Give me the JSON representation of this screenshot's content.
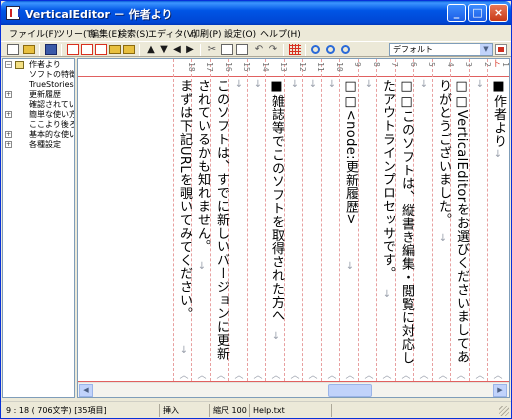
{
  "window": {
    "title": "VerticalEditor － 作者より",
    "minimize": "_",
    "maximize": "□",
    "close": "×"
  },
  "menu": [
    {
      "label": "ファイル(F)"
    },
    {
      "label": "ツリー(T)"
    },
    {
      "label": "編集(E)"
    },
    {
      "label": "検索(S)"
    },
    {
      "label": "エディタ(V)"
    },
    {
      "label": "印刷(P)"
    },
    {
      "label": "設定(O)"
    },
    {
      "label": "ヘルプ(H)"
    }
  ],
  "toolbar": {
    "font_select": "デフォルト",
    "font_select_arrow": "▼",
    "up_arrow": "▲",
    "down_arrow": "▼",
    "left_arrow": "◀",
    "right_arrow": "▶",
    "cut": "✂",
    "undo": "↶",
    "redo": "↷"
  },
  "tree": {
    "items": [
      {
        "exp": "−",
        "label": "作者より"
      },
      {
        "exp": "",
        "label": "ソフトの特徴"
      },
      {
        "exp": "",
        "label": "TrueStories"
      },
      {
        "exp": "+",
        "label": "更新履歴"
      },
      {
        "exp": "",
        "label": "確認されている"
      },
      {
        "exp": "+",
        "label": "簡単な使い方"
      },
      {
        "exp": "",
        "label": "ここより後ろ"
      },
      {
        "exp": "+",
        "label": "基本的な使い"
      },
      {
        "exp": "+",
        "label": "各種設定"
      }
    ]
  },
  "editor": {
    "top_marker": "卜",
    "lines": [
      {
        "num": "1",
        "text": "■作者より",
        "eol": "↓"
      },
      {
        "num": "2",
        "text": "",
        "eol": "↓"
      },
      {
        "num": "3",
        "text": "□□VerticalEditorをお選びくださいましてあ",
        "eol": ""
      },
      {
        "num": "4",
        "text": "りがとうございました。",
        "eol": "↓"
      },
      {
        "num": "5",
        "text": "",
        "eol": "↓"
      },
      {
        "num": "6",
        "text": "□□このソフトは、縦書き編集・閲覧に対応し",
        "eol": ""
      },
      {
        "num": "7",
        "text": "たアウトラインプロセッサです。",
        "eol": "↓"
      },
      {
        "num": "8",
        "text": "",
        "eol": "↓"
      },
      {
        "num": "9",
        "text": "□□<node:更新履歴>",
        "eol": "↓"
      },
      {
        "num": "10",
        "text": "",
        "eol": "↓"
      },
      {
        "num": "11",
        "text": "",
        "eol": "↓"
      },
      {
        "num": "12",
        "text": "",
        "eol": "↓"
      },
      {
        "num": "13",
        "text": "■雑誌等でこのソフトを取得された方へ",
        "eol": "↓"
      },
      {
        "num": "14",
        "text": "",
        "eol": "↓"
      },
      {
        "num": "15",
        "text": "",
        "eol": "↓"
      },
      {
        "num": "16",
        "text": "このソフトは、すでに新しいバージョンに更新",
        "eol": ""
      },
      {
        "num": "17",
        "text": "されているかも知れません。",
        "eol": "↓"
      },
      {
        "num": "18",
        "text": "まずは下記URLを覗いてみてください。",
        "eol": "↓"
      }
    ]
  },
  "status": {
    "position": "9 : 18 ( 706文字) [35項目]",
    "mode": "挿入",
    "zoom": "縮尺 100%",
    "file": "Help.txt"
  }
}
